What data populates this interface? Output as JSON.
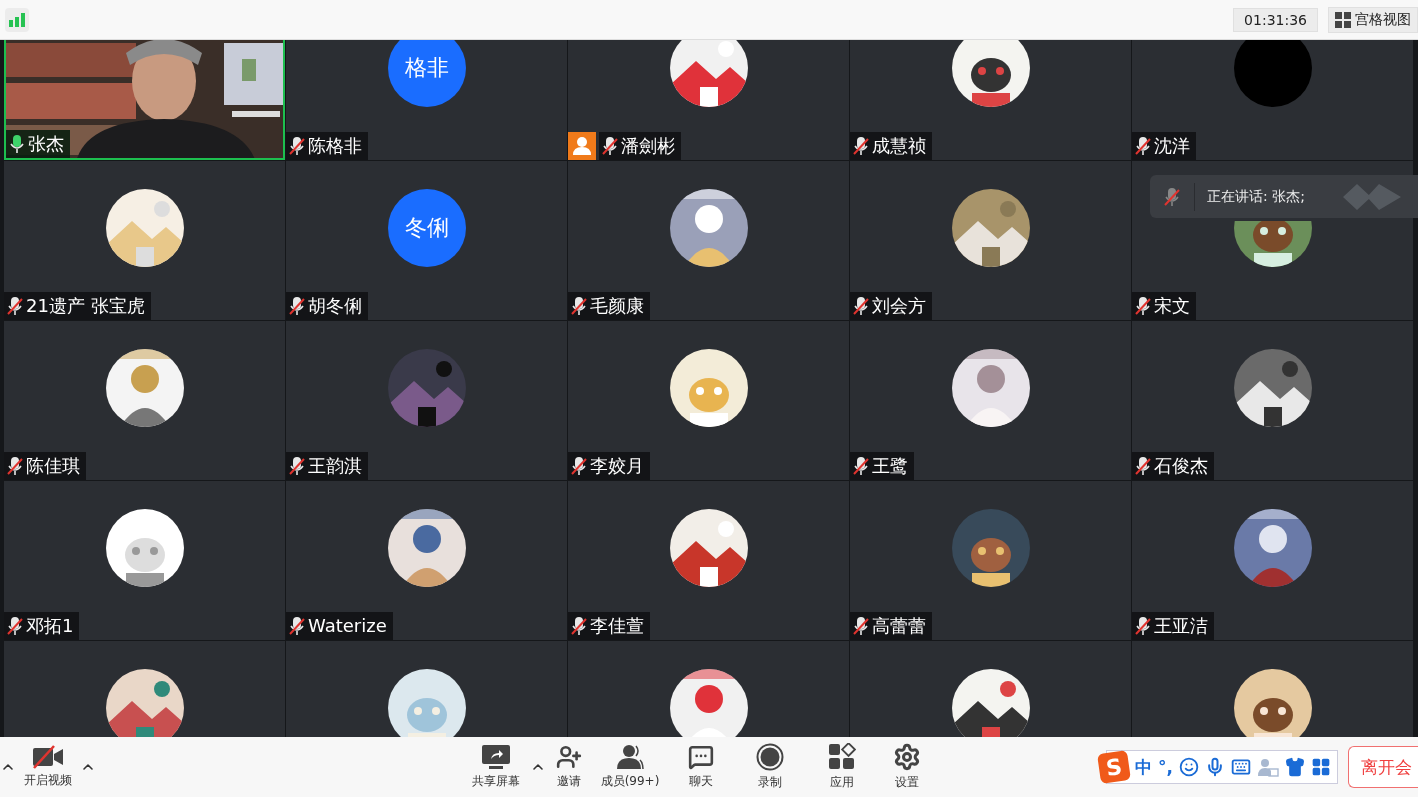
{
  "top_bar": {
    "timer": "01:31:36",
    "view_button": "宫格视图"
  },
  "tiles": [
    {
      "name": "张杰",
      "muted": false,
      "speaking": true,
      "host": false,
      "avatar": {
        "kind": "video"
      }
    },
    {
      "name": "陈格非",
      "muted": true,
      "speaking": false,
      "host": false,
      "avatar": {
        "kind": "text",
        "text": "格非",
        "color": "#1a6dff"
      }
    },
    {
      "name": "潘劍彬",
      "muted": true,
      "speaking": false,
      "host": true
    },
    {
      "name": "成慧祯",
      "muted": true,
      "speaking": false,
      "host": false
    },
    {
      "name": "沈洋",
      "muted": true,
      "speaking": false,
      "host": false,
      "avatar": {
        "kind": "blank"
      }
    },
    {
      "name": "21遗产 张宝虎",
      "muted": true,
      "speaking": false,
      "host": false
    },
    {
      "name": "胡冬俐",
      "muted": true,
      "speaking": false,
      "host": false,
      "avatar": {
        "kind": "text",
        "text": "冬俐",
        "color": "#1a6dff"
      }
    },
    {
      "name": "毛颜康",
      "muted": true,
      "speaking": false,
      "host": false
    },
    {
      "name": "刘会方",
      "muted": true,
      "speaking": false,
      "host": false
    },
    {
      "name": "宋文",
      "muted": true,
      "speaking": false,
      "host": false
    },
    {
      "name": "陈佳琪",
      "muted": true,
      "speaking": false,
      "host": false
    },
    {
      "name": "王韵淇",
      "muted": true,
      "speaking": false,
      "host": false
    },
    {
      "name": "李姣月",
      "muted": true,
      "speaking": false,
      "host": false
    },
    {
      "name": "王鹭",
      "muted": true,
      "speaking": false,
      "host": false
    },
    {
      "name": "石俊杰",
      "muted": true,
      "speaking": false,
      "host": false
    },
    {
      "name": "邓拓1",
      "muted": true,
      "speaking": false,
      "host": false
    },
    {
      "name": "Waterize",
      "muted": true,
      "speaking": false,
      "host": false
    },
    {
      "name": "李佳萱",
      "muted": true,
      "speaking": false,
      "host": false
    },
    {
      "name": "高蕾蕾",
      "muted": true,
      "speaking": false,
      "host": false
    },
    {
      "name": "王亚洁",
      "muted": true,
      "speaking": false,
      "host": false
    },
    {
      "speaking": false
    },
    {
      "speaking": false
    },
    {
      "speaking": false
    },
    {
      "speaking": false
    },
    {
      "speaking": false
    }
  ],
  "speaking_toast": {
    "text": "正在讲话: 张杰;",
    "muted": true
  },
  "toolbar": {
    "left": [
      {
        "kind": "video",
        "label": "开启视频"
      }
    ],
    "center": [
      {
        "kind": "share",
        "label": "共享屏幕"
      },
      {
        "kind": "invite",
        "label": "邀请"
      },
      {
        "kind": "members",
        "label": "成员(99+)"
      },
      {
        "kind": "chat",
        "label": "聊天"
      },
      {
        "kind": "record",
        "label": "录制"
      },
      {
        "kind": "apps",
        "label": "应用"
      },
      {
        "kind": "settings",
        "label": "设置"
      }
    ]
  },
  "ime": {
    "logo": "S",
    "mode": "中",
    "punctuation": "°,"
  },
  "leave_button": "离开会"
}
